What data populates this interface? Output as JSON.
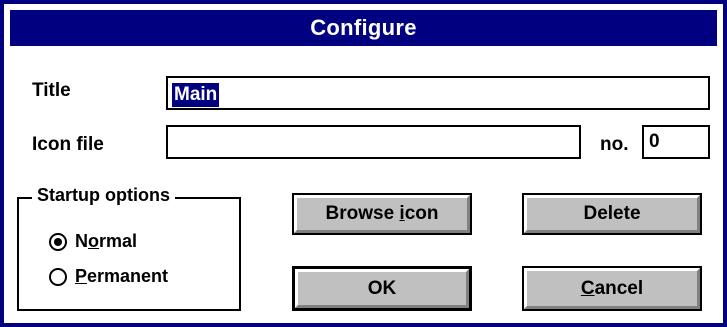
{
  "window": {
    "title": "Configure"
  },
  "fields": {
    "title_label": "Title",
    "title_value": "Main",
    "icon_label": "Icon file",
    "icon_value": "",
    "no_label": "no.",
    "no_value": "0"
  },
  "startup": {
    "legend": "Startup options",
    "options": [
      {
        "pre": "N",
        "key": "o",
        "post": "rmal",
        "selected": true
      },
      {
        "pre": "",
        "key": "P",
        "post": "ermanent",
        "selected": false
      }
    ]
  },
  "buttons": {
    "browse": {
      "pre": "Browse ",
      "key": "i",
      "post": "con"
    },
    "delete": "Delete",
    "ok": "OK",
    "cancel": {
      "pre": "",
      "key": "C",
      "post": "ancel"
    }
  }
}
